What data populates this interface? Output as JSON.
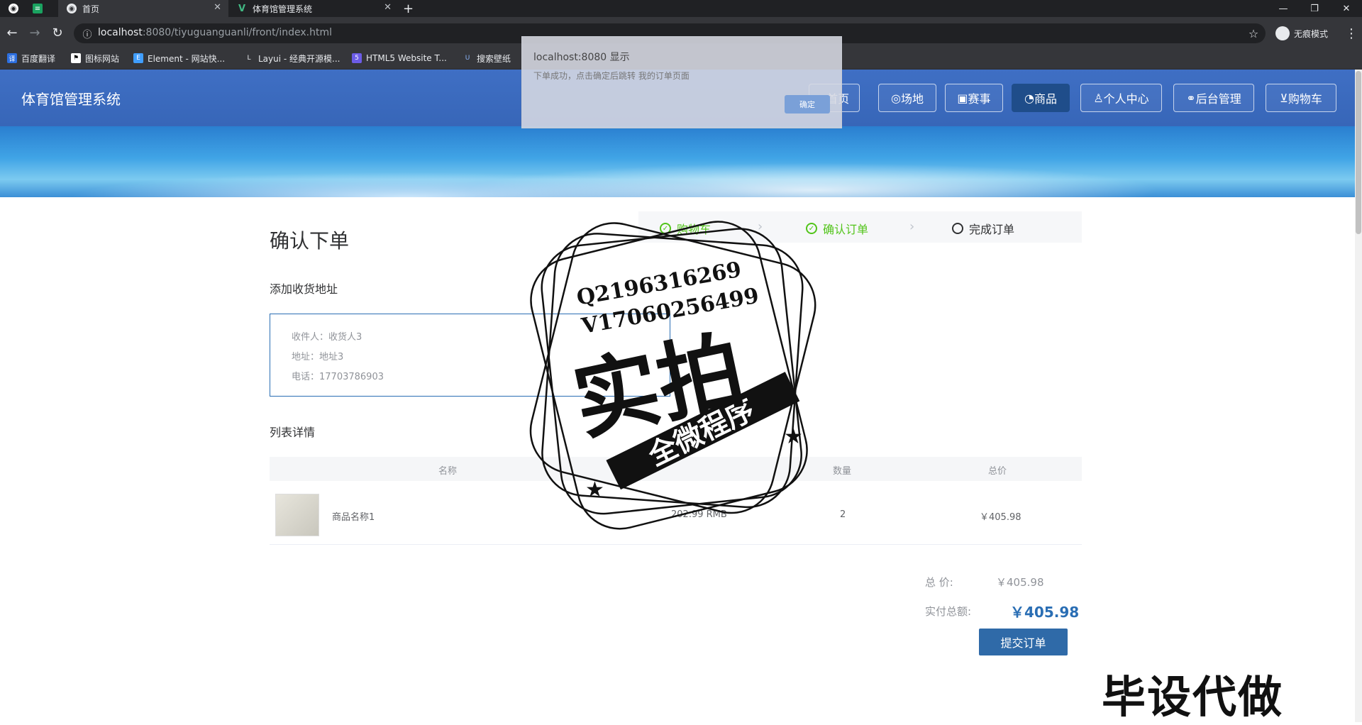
{
  "browser": {
    "tabs": [
      {
        "label": "首页",
        "active": true
      },
      {
        "label": "体育馆管理系统",
        "active": false
      }
    ],
    "url_host": "localhost",
    "url_rest": ":8080/tiyuguanguanli/front/index.html",
    "incognito_label": "无痕模式",
    "bookmarks": [
      "百度翻译",
      "图标网站",
      "Element - 网站快...",
      "Layui - 经典开源模...",
      "HTML5 Website T...",
      "搜索壁纸"
    ]
  },
  "alert": {
    "title": "localhost:8080 显示",
    "message": "下单成功，点击确定后跳转 我的订单页面",
    "ok_label": "确定"
  },
  "site": {
    "title": "体育馆管理系统",
    "nav": [
      {
        "label": "首页",
        "icon": "home-icon",
        "active": false
      },
      {
        "label": "场地",
        "icon": "venue-icon",
        "active": false
      },
      {
        "label": "赛事",
        "icon": "event-icon",
        "active": false
      },
      {
        "label": "商品",
        "icon": "goods-icon",
        "active": true
      },
      {
        "label": "个人中心",
        "icon": "user-icon",
        "active": false
      },
      {
        "label": "后台管理",
        "icon": "link-icon",
        "active": false
      },
      {
        "label": "购物车",
        "icon": "cart-icon",
        "active": false
      }
    ]
  },
  "order": {
    "page_title": "确认下单",
    "steps": [
      {
        "label": "购物车",
        "state": "done"
      },
      {
        "label": "确认订单",
        "state": "done"
      },
      {
        "label": "完成订单",
        "state": "current"
      }
    ],
    "address_section": "添加收货地址",
    "address": {
      "name": "收件人：收货人3",
      "addr": "地址：地址3",
      "phone": "电话：17703786903"
    },
    "list_section": "列表详情",
    "columns": [
      "名称",
      "数量",
      "总价"
    ],
    "items": [
      {
        "name": "商品名称1",
        "price": "202.99 RMB",
        "qty": "2",
        "total": "￥405.98"
      }
    ],
    "total_label": "总  价:",
    "total_value": "￥405.98",
    "pay_label": "实付总额:",
    "pay_value": "￥405.98",
    "submit_label": "提交订单"
  },
  "watermark": {
    "qq": "Q2196316269",
    "wx": "V17060256499",
    "big": "实拍",
    "ribbon": "全微程序",
    "corner": "毕设代做"
  },
  "colors": {
    "header": "#3766b8",
    "accent": "#2a6eb4",
    "success": "#52c41a"
  }
}
